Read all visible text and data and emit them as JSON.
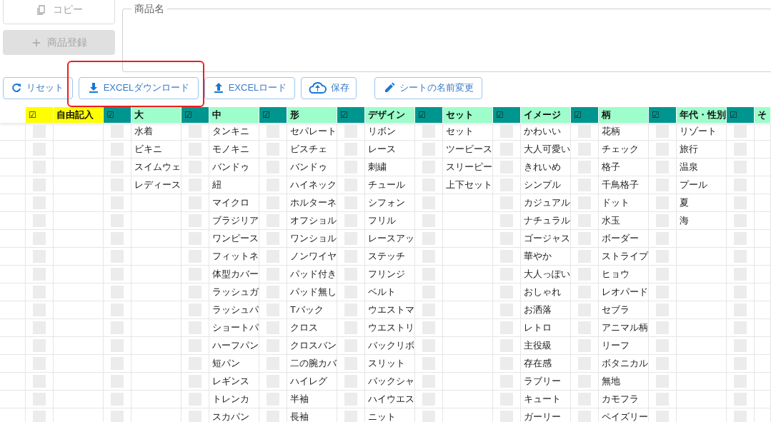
{
  "left_buttons": [
    {
      "label": "コピー",
      "kind": "copy",
      "disabled": true
    },
    {
      "label": "商品登録",
      "kind": "add",
      "disabled": true
    }
  ],
  "product_name": {
    "label": "商品名"
  },
  "toolbar": [
    {
      "label": "リセット",
      "kind": "reset"
    },
    {
      "label": "EXCELダウンロード",
      "kind": "download"
    },
    {
      "label": "EXCELロード",
      "kind": "upload"
    },
    {
      "label": "保存",
      "kind": "save"
    },
    {
      "label": "シートの名前変更",
      "kind": "rename"
    }
  ],
  "table": {
    "columns": [
      {
        "kind": "free",
        "check_label": "☑",
        "title": "自由記入",
        "checks": [
          false,
          false,
          false,
          false,
          false,
          false,
          false,
          false,
          false,
          false,
          false,
          false,
          false,
          false,
          false,
          false,
          false
        ]
      },
      {
        "kind": "category",
        "check_label": "☑",
        "title": "大",
        "checks": [
          false,
          false,
          false,
          false,
          false,
          false,
          false,
          false,
          false,
          false,
          false,
          false,
          false,
          false,
          false,
          false,
          false
        ],
        "values": [
          "水着",
          "ビキニ",
          "スイムウェ",
          "レディース"
        ]
      },
      {
        "kind": "category",
        "check_label": "☑",
        "title": "中",
        "checks": [
          false,
          false,
          false,
          false,
          false,
          false,
          false,
          false,
          false,
          false,
          false,
          false,
          false,
          false,
          false,
          false,
          false
        ],
        "values": [
          "タンキニ",
          "モノキニ",
          "バンドゥ",
          "紐",
          "マイクロ",
          "ブラジリア",
          "ワンピース",
          "フィットネ",
          "体型カバー",
          "ラッシュガ",
          "ラッシュパ",
          "ショートパ",
          "ハーフパン",
          "短パン",
          "レギンス",
          "トレンカ",
          "スカパン"
        ]
      },
      {
        "kind": "category",
        "check_label": "☑",
        "title": "形",
        "checks": [
          false,
          false,
          false,
          false,
          false,
          false,
          false,
          false,
          false,
          false,
          false,
          false,
          false,
          false,
          false,
          false,
          false
        ],
        "values": [
          "セパレート",
          "ビスチェ",
          "バンドゥ",
          "ハイネック",
          "ホルターネ",
          "オフショル",
          "ワンショル",
          "ノンワイヤ",
          "パッド付き",
          "パッド無し",
          "Tバック",
          "クロス",
          "クロスバン",
          "二の腕カバ",
          "ハイレグ",
          "半袖",
          "長袖"
        ]
      },
      {
        "kind": "category",
        "check_label": "☑",
        "title": "デザイン",
        "checks": [
          false,
          false,
          false,
          false,
          false,
          false,
          false,
          false,
          false,
          false,
          false,
          false,
          false,
          false,
          false,
          false,
          false
        ],
        "values": [
          "リボン",
          "レース",
          "刺繍",
          "チュール",
          "シフォン",
          "フリル",
          "レースアッ",
          "ステッチ",
          "フリンジ",
          "ベルト",
          "ウエストマ",
          "ウエストリ",
          "バックリボ",
          "スリット",
          "バックシャ",
          "ハイウエス",
          "ニット"
        ]
      },
      {
        "kind": "category",
        "check_label": "☑",
        "title": "セット",
        "checks": [
          false,
          false,
          false,
          false,
          false,
          false,
          false,
          false,
          false,
          false,
          false,
          false,
          false,
          false,
          false,
          false,
          false
        ],
        "values": [
          "セット",
          "ツーピース",
          "スリーピー",
          "上下セット"
        ]
      },
      {
        "kind": "category",
        "check_label": "☑",
        "title": "イメージ",
        "checks": [
          false,
          false,
          false,
          false,
          false,
          false,
          false,
          false,
          false,
          false,
          false,
          false,
          false,
          false,
          false,
          false,
          false
        ],
        "values": [
          "かわいい",
          "大人可愛い",
          "きれいめ",
          "シンプル",
          "カジュアル",
          "ナチュラル",
          "ゴージャス",
          "華やか",
          "大人っぽい",
          "おしゃれ",
          "お洒落",
          "レトロ",
          "主役級",
          "存在感",
          "ラブリー",
          "キュート",
          "ガーリー"
        ]
      },
      {
        "kind": "category",
        "check_label": "☑",
        "title": "柄",
        "checks": [
          false,
          false,
          false,
          false,
          false,
          false,
          false,
          false,
          false,
          false,
          false,
          false,
          false,
          false,
          false,
          false,
          false
        ],
        "values": [
          "花柄",
          "チェック",
          "格子",
          "千鳥格子",
          "ドット",
          "水玉",
          "ボーダー",
          "ストライプ",
          "ヒョウ",
          "レオパード",
          "セブラ",
          "アニマル柄",
          "リーフ",
          "ボタニカル",
          "無地",
          "カモフラ",
          "ペイズリー"
        ]
      },
      {
        "kind": "category",
        "check_label": "☑",
        "title": "年代・性別",
        "checks": [
          false,
          false,
          false,
          false,
          false,
          false,
          false,
          false,
          false,
          false,
          false,
          false,
          false,
          false,
          false,
          false,
          false
        ],
        "values": [
          "リゾート",
          "旅行",
          "温泉",
          "プール",
          "夏",
          "海"
        ]
      },
      {
        "kind": "category",
        "check_label": "☑",
        "title": "そ",
        "checks": [
          false,
          false,
          false,
          false,
          false,
          false,
          false,
          false,
          false,
          false,
          false,
          false,
          false,
          false,
          false,
          false,
          false
        ]
      }
    ]
  }
}
